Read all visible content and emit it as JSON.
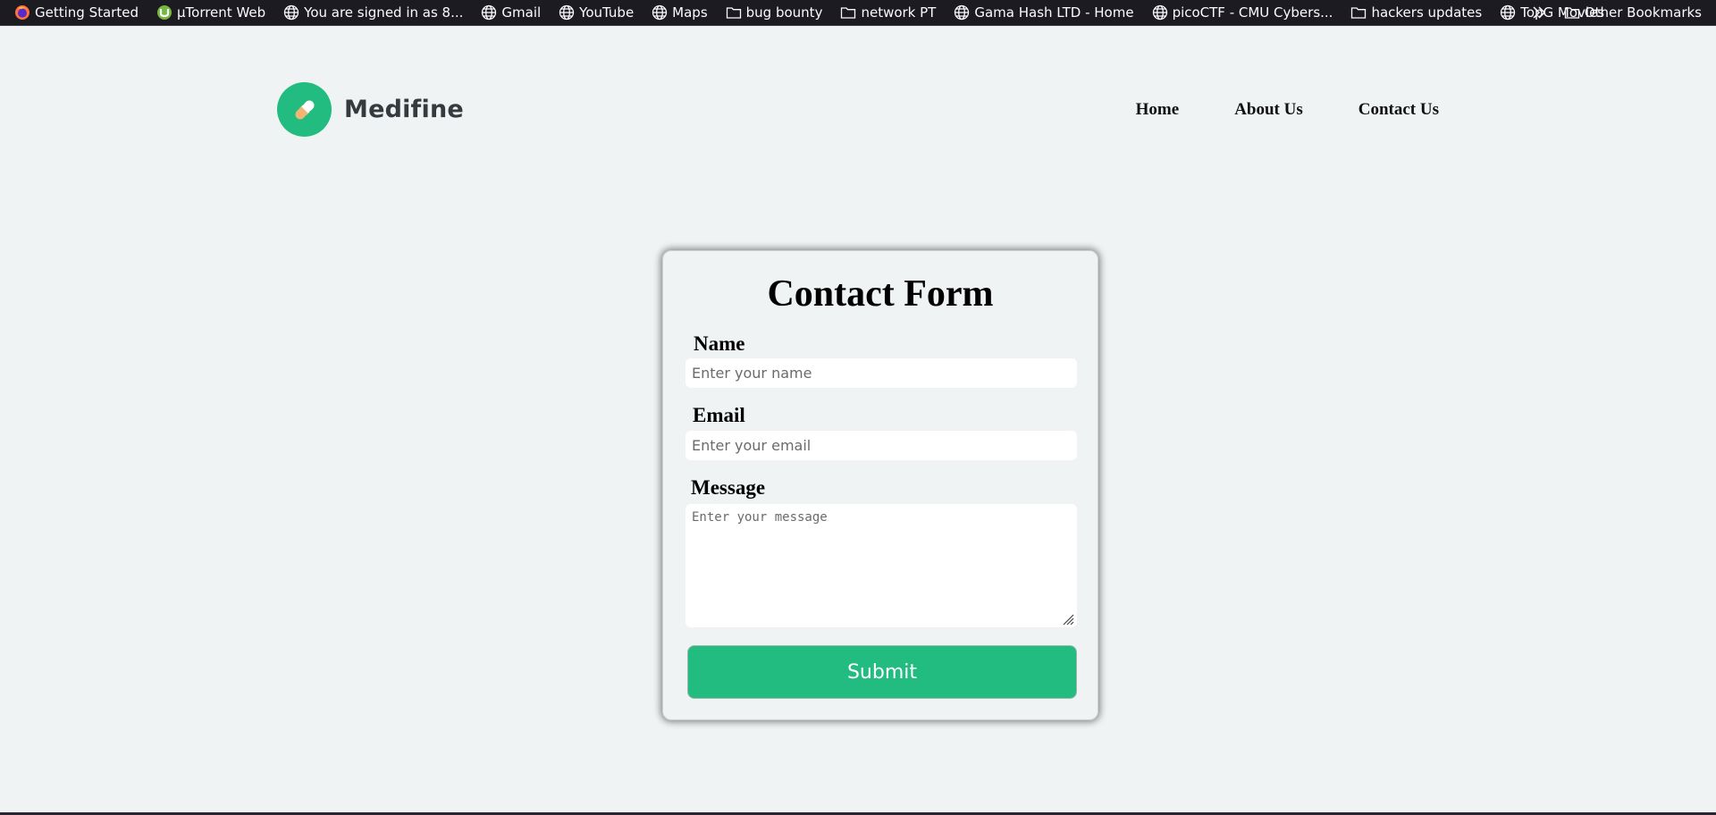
{
  "bookmarks": {
    "items": [
      {
        "label": "Getting Started",
        "icon": "firefox-icon"
      },
      {
        "label": "µTorrent Web",
        "icon": "utorrent-icon"
      },
      {
        "label": "You are signed in as 8...",
        "icon": "globe-icon"
      },
      {
        "label": "Gmail",
        "icon": "globe-icon"
      },
      {
        "label": "YouTube",
        "icon": "globe-icon"
      },
      {
        "label": "Maps",
        "icon": "globe-icon"
      },
      {
        "label": "bug bounty",
        "icon": "folder-icon"
      },
      {
        "label": "network PT",
        "icon": "folder-icon"
      },
      {
        "label": "Gama Hash LTD - Home",
        "icon": "globe-icon"
      },
      {
        "label": "picoCTF - CMU Cybers...",
        "icon": "globe-icon"
      },
      {
        "label": "hackers updates",
        "icon": "folder-icon"
      },
      {
        "label": "TopG Movies",
        "icon": "globe-icon"
      }
    ],
    "overflow_icon": "double-chevron-right-icon",
    "other": {
      "label": "Other Bookmarks",
      "icon": "folder-icon"
    }
  },
  "header": {
    "brand_name": "Medifine",
    "logo_icon": "pill-icon",
    "nav": [
      {
        "label": "Home"
      },
      {
        "label": "About Us"
      },
      {
        "label": "Contact Us"
      }
    ]
  },
  "form": {
    "title": "Contact Form",
    "name_label": "Name",
    "name_placeholder": "Enter your name",
    "email_label": "Email",
    "email_placeholder": "Enter your email",
    "message_label": "Message",
    "message_placeholder": "Enter your message",
    "submit_label": "Submit"
  },
  "colors": {
    "page_bg": "#eff3f4",
    "brand_green": "#22bb80",
    "bookmarks_bg": "#1c1b22",
    "pill_orange": "#f3b574"
  }
}
